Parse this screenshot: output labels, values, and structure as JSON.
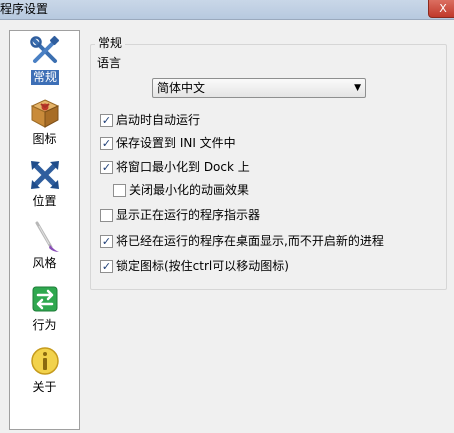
{
  "window": {
    "title": "程序设置",
    "close_label": "X"
  },
  "sidebar": {
    "items": [
      {
        "id": "general",
        "label": "常规",
        "icon": "tools-icon",
        "active": true
      },
      {
        "id": "icon",
        "label": "图标",
        "icon": "package-icon",
        "active": false
      },
      {
        "id": "position",
        "label": "位置",
        "icon": "position-arrows-icon",
        "active": false
      },
      {
        "id": "style",
        "label": "风格",
        "icon": "brush-icon",
        "active": false
      },
      {
        "id": "behavior",
        "label": "行为",
        "icon": "arrows-switch-icon",
        "active": false
      },
      {
        "id": "about",
        "label": "关于",
        "icon": "info-icon",
        "active": false
      }
    ]
  },
  "general": {
    "group_title": "常规",
    "language_label": "语言",
    "language_value": "简体中文",
    "options": [
      {
        "label": "启动时自动运行",
        "checked": true
      },
      {
        "label": "保存设置到 INI 文件中",
        "checked": true
      },
      {
        "label": "将窗口最小化到 Dock 上",
        "checked": true
      },
      {
        "label": "关闭最小化的动画效果",
        "checked": false
      },
      {
        "label": "显示正在运行的程序指示器",
        "checked": false
      },
      {
        "label": "将已经在运行的程序在桌面显示,而不开启新的进程",
        "checked": true
      },
      {
        "label": "锁定图标(按住ctrl可以移动图标)",
        "checked": true
      }
    ]
  }
}
